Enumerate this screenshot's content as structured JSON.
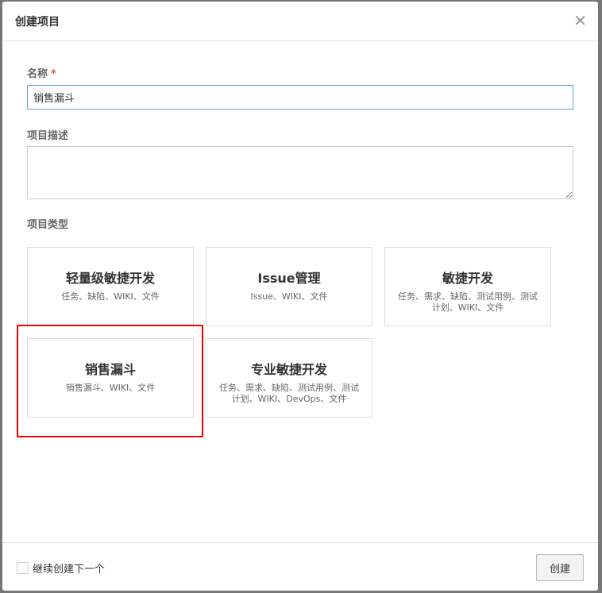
{
  "dialog": {
    "title": "创建项目",
    "close_icon": "close-icon"
  },
  "form": {
    "name_label": "名称",
    "required_mark": "*",
    "name_value": "销售漏斗",
    "desc_label": "项目描述",
    "desc_value": "",
    "type_label": "项目类型",
    "types": [
      {
        "title": "轻量级敏捷开发",
        "desc": "任务、缺陷、WIKI、文件"
      },
      {
        "title": "Issue管理",
        "desc": "Issue、WIKI、文件"
      },
      {
        "title": "敏捷开发",
        "desc": "任务、需求、缺陷、测试用例、测试计划、WIKI、文件"
      },
      {
        "title": "销售漏斗",
        "desc": "销售漏斗、WIKI、文件",
        "selected": true
      },
      {
        "title": "专业敏捷开发",
        "desc": "任务、需求、缺陷、测试用例、测试计划、WIKI、DevOps、文件"
      }
    ]
  },
  "footer": {
    "continue_label": "继续创建下一个",
    "continue_checked": false,
    "create_label": "创建"
  },
  "selection_color": "#e00000"
}
